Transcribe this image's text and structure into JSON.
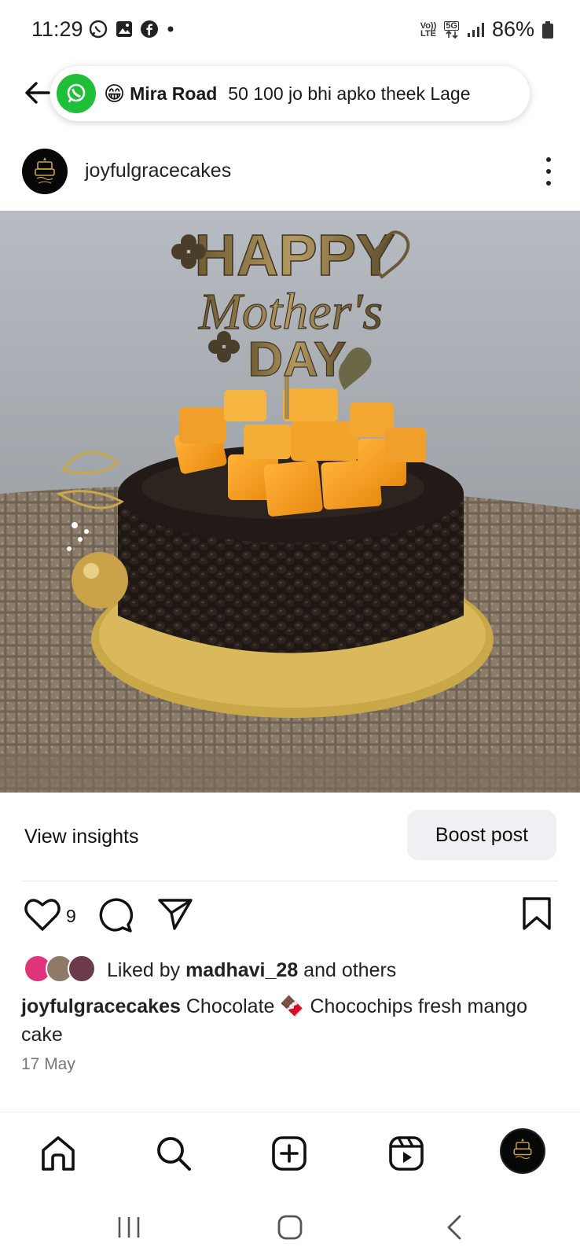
{
  "status_bar": {
    "time": "11:29",
    "battery": "86%",
    "net_top": "Vo))",
    "net_bottom": "LTE",
    "gen_label": "5G"
  },
  "notification": {
    "sender": "Mira Road",
    "message": "50 100 jo bhi apko theek Lage",
    "emoji": "😁",
    "app_icon": "whatsapp-icon"
  },
  "post": {
    "username": "joyfulgracecakes",
    "image_content": {
      "topper_line1": "HAPPY",
      "topper_line2": "Mother's",
      "topper_line3": "DAY"
    },
    "insights_label": "View insights",
    "boost_label": "Boost post",
    "like_count": "9",
    "liked_by_prefix": "Liked by",
    "liked_by_user": "madhavi_28",
    "liked_by_suffix": "and others",
    "caption_user": "joyfulgracecakes",
    "caption_text": "Chocolate 🍫 Chocochips fresh mango cake",
    "date": "17 May"
  },
  "bottom_nav": {
    "items": [
      "home-icon",
      "search-icon",
      "create-icon",
      "reels-icon",
      "profile-avatar"
    ]
  },
  "colors": {
    "whatsapp_green": "#1fbf39",
    "boost_bg": "#eff0f3",
    "date_gray": "#777777"
  }
}
